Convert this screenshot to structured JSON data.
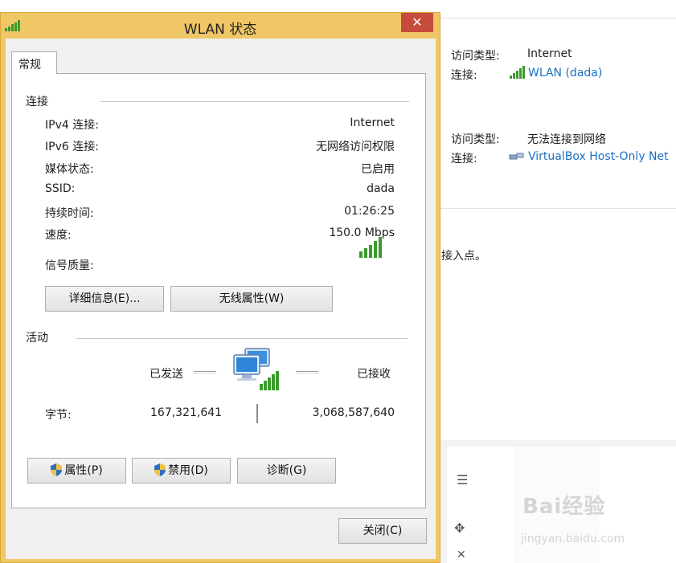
{
  "background": {
    "row1": {
      "access_label": "访问类型:",
      "access_value": "Internet",
      "conn_label": "连接:",
      "conn_value": "WLAN (dada)"
    },
    "row2": {
      "access_label": "访问类型:",
      "access_value": "无法连接到网络",
      "conn_label": "连接:",
      "conn_value": "VirtualBox Host-Only Net"
    },
    "partial_text": "接入点。",
    "watermark": "Bai经验",
    "watermark_sub": "jingyan.baidu.com"
  },
  "dialog": {
    "title": "WLAN 状态",
    "close_glyph": "✕",
    "tab_label": "常规",
    "connection": {
      "group_label": "连接",
      "rows": [
        {
          "label": "IPv4 连接:",
          "value": "Internet"
        },
        {
          "label": "IPv6 连接:",
          "value": "无网络访问权限"
        },
        {
          "label": "媒体状态:",
          "value": "已启用"
        },
        {
          "label": "SSID:",
          "value": "dada"
        },
        {
          "label": "持续时间:",
          "value": "01:26:25"
        },
        {
          "label": "速度:",
          "value": "150.0 Mbps"
        }
      ],
      "signal_label": "信号质量:",
      "signal_bars": 5
    },
    "buttons_top": {
      "details": "详细信息(E)...",
      "wireless": "无线属性(W)"
    },
    "activity": {
      "group_label": "活动",
      "sent_label": "已发送",
      "received_label": "已接收",
      "bytes_label": "字节:",
      "bytes_sent": "167,321,641",
      "bytes_received": "3,068,587,640"
    },
    "buttons_bottom": {
      "properties": "属性(P)",
      "disable": "禁用(D)",
      "diagnose": "诊断(G)"
    },
    "close_button": "关闭(C)"
  },
  "colors": {
    "title_bar": "#f0c766",
    "close": "#c74b3c",
    "link": "#1a6fc4",
    "signal": "#3c9a2e"
  }
}
